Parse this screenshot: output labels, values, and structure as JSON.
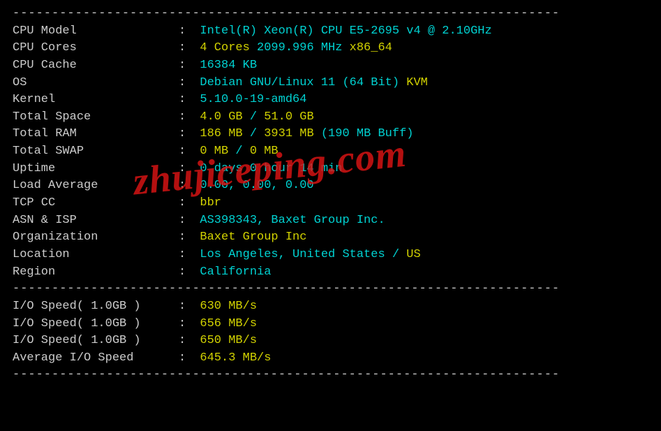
{
  "dashes": "----------------------------------------------------------------------",
  "rows": [
    {
      "label": "CPU Model            ",
      "segs": [
        {
          "t": "Intel(R) Xeon(R) CPU E5-2695 v4 @ 2.10GHz",
          "c": "cyan"
        }
      ]
    },
    {
      "label": "CPU Cores            ",
      "segs": [
        {
          "t": "4 Cores ",
          "c": "yellow"
        },
        {
          "t": "2099.996 MHz ",
          "c": "cyan"
        },
        {
          "t": "x86_64",
          "c": "yellow"
        }
      ]
    },
    {
      "label": "CPU Cache            ",
      "segs": [
        {
          "t": "16384 KB",
          "c": "cyan"
        }
      ]
    },
    {
      "label": "OS                   ",
      "segs": [
        {
          "t": "Debian GNU/Linux 11 (64 Bit) ",
          "c": "cyan"
        },
        {
          "t": "KVM",
          "c": "yellow"
        }
      ]
    },
    {
      "label": "Kernel               ",
      "segs": [
        {
          "t": "5.10.0-19-amd64",
          "c": "cyan"
        }
      ]
    },
    {
      "label": "Total Space          ",
      "segs": [
        {
          "t": "4.0 GB ",
          "c": "yellow"
        },
        {
          "t": "/ ",
          "c": "cyan"
        },
        {
          "t": "51.0 GB",
          "c": "yellow"
        }
      ]
    },
    {
      "label": "Total RAM            ",
      "segs": [
        {
          "t": "186 MB ",
          "c": "yellow"
        },
        {
          "t": "/ ",
          "c": "cyan"
        },
        {
          "t": "3931 MB ",
          "c": "yellow"
        },
        {
          "t": "(190 MB Buff)",
          "c": "cyan"
        }
      ]
    },
    {
      "label": "Total SWAP           ",
      "segs": [
        {
          "t": "0 MB ",
          "c": "yellow"
        },
        {
          "t": "/ ",
          "c": "cyan"
        },
        {
          "t": "0 MB",
          "c": "yellow"
        }
      ]
    },
    {
      "label": "Uptime               ",
      "segs": [
        {
          "t": "0 days 0 hour 14 min",
          "c": "cyan"
        }
      ]
    },
    {
      "label": "Load Average         ",
      "segs": [
        {
          "t": "0.00, 0.00, 0.00",
          "c": "cyan"
        }
      ]
    },
    {
      "label": "TCP CC               ",
      "segs": [
        {
          "t": "bbr",
          "c": "yellow"
        }
      ]
    },
    {
      "label": "ASN & ISP            ",
      "segs": [
        {
          "t": "AS398343, Baxet Group Inc.",
          "c": "cyan"
        }
      ]
    },
    {
      "label": "Organization         ",
      "segs": [
        {
          "t": "Baxet Group Inc",
          "c": "yellow"
        }
      ]
    },
    {
      "label": "Location             ",
      "segs": [
        {
          "t": "Los Angeles, United States / ",
          "c": "cyan"
        },
        {
          "t": "US",
          "c": "yellow"
        }
      ]
    },
    {
      "label": "Region               ",
      "segs": [
        {
          "t": "California",
          "c": "cyan"
        }
      ]
    }
  ],
  "io_rows": [
    {
      "label": "I/O Speed( 1.0GB )   ",
      "segs": [
        {
          "t": "630 MB/s",
          "c": "yellow"
        }
      ]
    },
    {
      "label": "I/O Speed( 1.0GB )   ",
      "segs": [
        {
          "t": "656 MB/s",
          "c": "yellow"
        }
      ]
    },
    {
      "label": "I/O Speed( 1.0GB )   ",
      "segs": [
        {
          "t": "650 MB/s",
          "c": "yellow"
        }
      ]
    },
    {
      "label": "Average I/O Speed    ",
      "segs": [
        {
          "t": "645.3 MB/s",
          "c": "yellow"
        }
      ]
    }
  ],
  "watermark": "zhujiceping.com"
}
